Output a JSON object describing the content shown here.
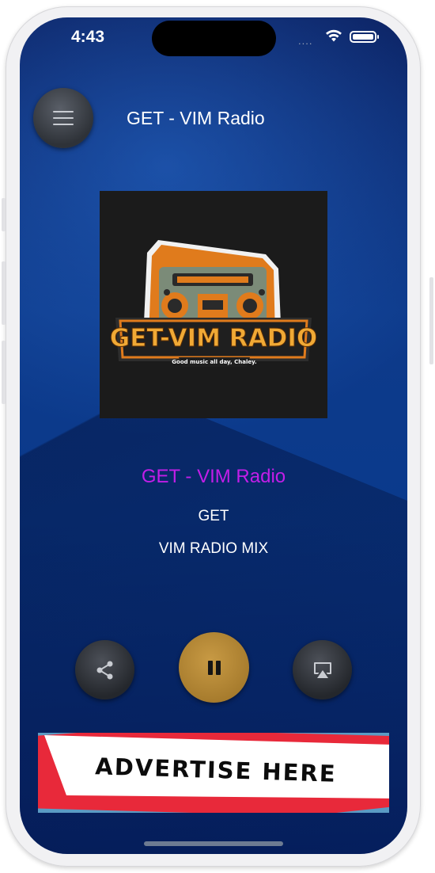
{
  "status_bar": {
    "time": "4:43",
    "signal": "....",
    "icons": [
      "wifi-icon",
      "battery-icon"
    ]
  },
  "header": {
    "menu_icon": "hamburger-icon",
    "title": "GET - VIM Radio"
  },
  "artwork": {
    "logo_text": "GET-VIM RADIO",
    "logo_tagline": "Good music all day, Chaley."
  },
  "now_playing": {
    "station": "GET - VIM Radio",
    "artist": "GET",
    "title": "VIM RADIO MIX"
  },
  "controls": {
    "share_icon": "share-icon",
    "play_state_icon": "pause-icon",
    "airplay_icon": "airplay-icon"
  },
  "ad": {
    "text": "ADVERTISE HERE"
  },
  "colors": {
    "station_name": "#c21ee8",
    "pause_button": "#b8893a",
    "background": "#0e3a8a"
  }
}
